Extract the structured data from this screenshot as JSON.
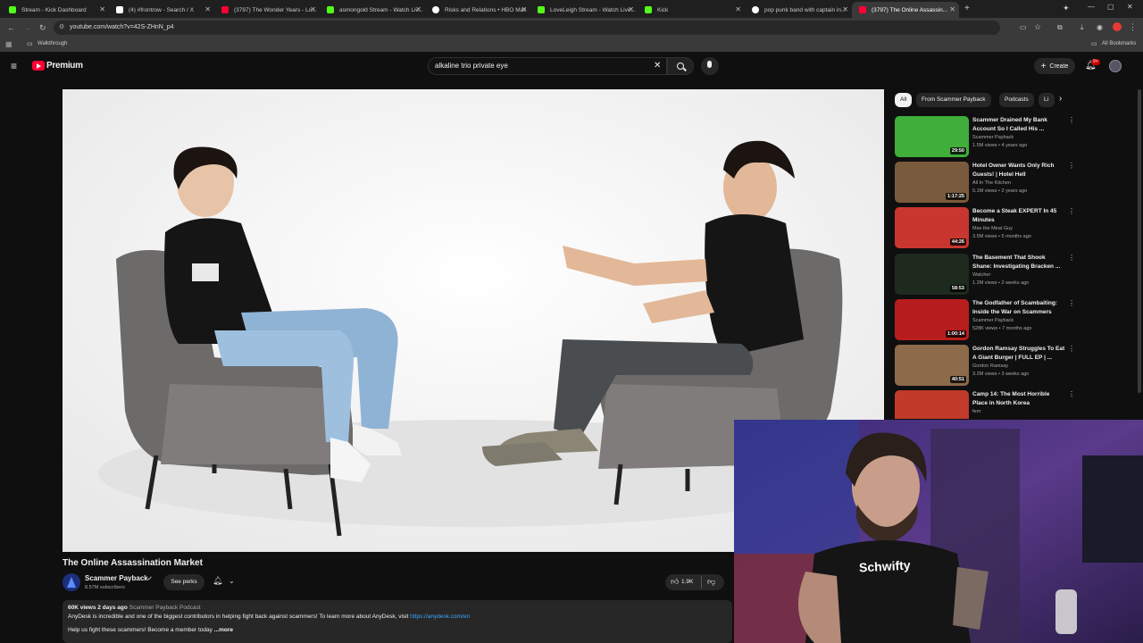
{
  "browser": {
    "tabs": [
      {
        "label": "Stream - Kick Dashboard",
        "color": "#53fc18"
      },
      {
        "label": "(4) #frontrow - Search / X",
        "color": "#ffffff"
      },
      {
        "label": "(3797) The Wonder Years - Lo...",
        "color": "#ff0033"
      },
      {
        "label": "asmongold Stream - Watch Liv...",
        "color": "#53fc18"
      },
      {
        "label": "Risks and Relations • HBO Max",
        "color": "#ffffff"
      },
      {
        "label": "LoveLeigh Stream - Watch Live...",
        "color": "#53fc18"
      },
      {
        "label": "Kick",
        "color": "#53fc18"
      },
      {
        "label": "pop punk band with captain in...",
        "color": "#ffffff"
      },
      {
        "label": "(3797) The Online Assassin...",
        "color": "#ff0033"
      }
    ],
    "url": "youtube.com/watch?v=42S-ZHnN_p4",
    "bookmark_folder": "Walkthrough",
    "all_bookmarks": "All Bookmarks"
  },
  "youtube": {
    "logo_text": "Premium",
    "search_value": "alkaline trio private eye",
    "create_label": "Create",
    "notification_count": "9+"
  },
  "chips": [
    "All",
    "From Scammer Payback",
    "Podcasts",
    "Li"
  ],
  "recommendations": [
    {
      "title": "Scammer Drained My Bank Account So I Called His ...",
      "channel": "Scammer Payback",
      "meta": "1.5M views • 4 years ago",
      "duration": "29:50",
      "thumb": "#3fae3a"
    },
    {
      "title": "Hotel Owner Wants Only Rich Guests! | Hotel Hell",
      "channel": "All In The Kitchen",
      "meta": "5.1M views • 2 years ago",
      "duration": "1:17:25",
      "thumb": "#7a5a3c"
    },
    {
      "title": "Become a Steak EXPERT In 45 Minutes",
      "channel": "Max the Meat Guy",
      "meta": "3.5M views • 5 months ago",
      "duration": "44:26",
      "thumb": "#c8362f"
    },
    {
      "title": "The Basement That Shook Shane: Investigating Bracken ...",
      "channel": "Watcher",
      "meta": "1.2M views • 2 weeks ago",
      "duration": "58:53",
      "thumb": "#1e2a1e"
    },
    {
      "title": "The Godfather of Scambaiting: Inside the War on Scammers",
      "channel": "Scammer Payback",
      "meta": "528K views • 7 months ago",
      "duration": "1:00:14",
      "thumb": "#b81d1d"
    },
    {
      "title": "Gordon Ramsay Struggles To Eat A Giant Burger | FULL EP | ...",
      "channel": "Gordon Ramsay",
      "meta": "3.2M views • 3 weeks ago",
      "duration": "40:51",
      "thumb": "#8c6a4a"
    },
    {
      "title": "Camp 14: The Most Horrible Place in North Korea",
      "channel": "fern",
      "meta": "",
      "duration": "",
      "thumb": "#c23a2a"
    }
  ],
  "video": {
    "title": "The Online Assassination Market",
    "channel": "Scammer Payback",
    "subscribers": "8.57M subscribers",
    "perks_label": "See perks",
    "likes": "1.9K",
    "views": "60K views",
    "age": "2 days ago",
    "tag": "Scammer Payback Podcast",
    "description_line1": "AnyDesk is incredible and one of the biggest contributors in helping fight back against scammers! To learn more about AnyDesk, visit",
    "description_link": "https://anydesk.com/en",
    "description_line2": "Help us fight these scammers! Become a member today",
    "more_label": "...more"
  },
  "webcam": {
    "shirt_text": "Schwifty"
  }
}
